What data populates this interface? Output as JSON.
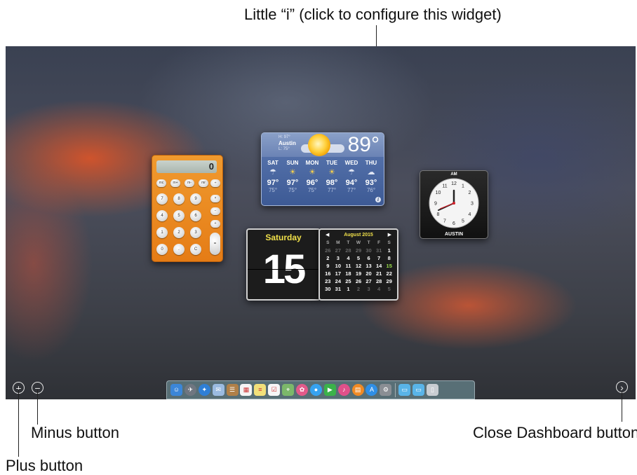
{
  "callouts": {
    "info": "Little “i” (click to configure this widget)",
    "minus": "Minus button",
    "close": "Close Dashboard button",
    "plus": "Plus button"
  },
  "calculator": {
    "display": "0",
    "mem_keys": [
      "mc",
      "m+",
      "m-",
      "mr"
    ],
    "keys": [
      "7",
      "8",
      "9",
      "4",
      "5",
      "6",
      "1",
      "2",
      "3",
      "0",
      ".",
      "C"
    ],
    "ops": [
      "÷",
      "×",
      "−",
      "+",
      "="
    ]
  },
  "weather": {
    "city": "Austin",
    "high": "H: 97°",
    "low": "L: 75°",
    "current": "89°",
    "forecast": [
      {
        "day": "SAT",
        "hi": "97°",
        "lo": "75°",
        "icon": "thunderstorm-icon"
      },
      {
        "day": "SUN",
        "hi": "97°",
        "lo": "75°",
        "icon": "partly-sunny-icon"
      },
      {
        "day": "MON",
        "hi": "96°",
        "lo": "75°",
        "icon": "partly-sunny-icon"
      },
      {
        "day": "TUE",
        "hi": "98°",
        "lo": "77°",
        "icon": "partly-sunny-icon"
      },
      {
        "day": "WED",
        "hi": "94°",
        "lo": "77°",
        "icon": "thunderstorm-icon"
      },
      {
        "day": "THU",
        "hi": "93°",
        "lo": "76°",
        "icon": "cloudy-icon"
      }
    ],
    "info_button": "i"
  },
  "clock": {
    "ampm": "AM",
    "city": "AUSTIN",
    "numbers": [
      "12",
      "1",
      "2",
      "3",
      "4",
      "5",
      "6",
      "7",
      "8",
      "9",
      "10",
      "11"
    ]
  },
  "date_widget": {
    "weekday": "Saturday",
    "day": "15"
  },
  "calendar": {
    "month": "August 2015",
    "prev": "◀",
    "next": "▶",
    "weekdays": [
      "S",
      "M",
      "T",
      "W",
      "T",
      "F",
      "S"
    ],
    "days": [
      "26",
      "27",
      "28",
      "29",
      "30",
      "31",
      "1",
      "2",
      "3",
      "4",
      "5",
      "6",
      "7",
      "8",
      "9",
      "10",
      "11",
      "12",
      "13",
      "14",
      "15",
      "16",
      "17",
      "18",
      "19",
      "20",
      "21",
      "22",
      "23",
      "24",
      "25",
      "26",
      "27",
      "28",
      "29",
      "30",
      "31",
      "1",
      "2",
      "3",
      "4",
      "5"
    ],
    "today": "15"
  },
  "dock": {
    "apps": [
      {
        "name": "finder-icon",
        "color": "#3b86d8"
      },
      {
        "name": "launchpad-icon",
        "color": "#6f7680"
      },
      {
        "name": "safari-icon",
        "color": "#2e7fd6"
      },
      {
        "name": "mail-icon",
        "color": "#9bbbe0"
      },
      {
        "name": "contacts-icon",
        "color": "#b08048"
      },
      {
        "name": "calendar-icon",
        "color": "#f4f4f4"
      },
      {
        "name": "notes-icon",
        "color": "#f2e07a"
      },
      {
        "name": "reminders-icon",
        "color": "#f6f6f6"
      },
      {
        "name": "maps-icon",
        "color": "#7cb86a"
      },
      {
        "name": "photos-icon",
        "color": "#e25a8a"
      },
      {
        "name": "messages-icon",
        "color": "#36a3f0"
      },
      {
        "name": "facetime-icon",
        "color": "#3bb24a"
      },
      {
        "name": "itunes-icon",
        "color": "#e0508a"
      },
      {
        "name": "ibooks-icon",
        "color": "#f08a24"
      },
      {
        "name": "app-store-icon",
        "color": "#2f8fe6"
      },
      {
        "name": "system-preferences-icon",
        "color": "#8a8e94"
      }
    ],
    "right": [
      {
        "name": "applications-folder-icon",
        "color": "#59b4e8"
      },
      {
        "name": "downloads-folder-icon",
        "color": "#59b4e8"
      },
      {
        "name": "trash-icon",
        "color": "#c8cdd2"
      }
    ]
  },
  "controls": {
    "plus": "+",
    "minus": "−",
    "close": "›"
  }
}
